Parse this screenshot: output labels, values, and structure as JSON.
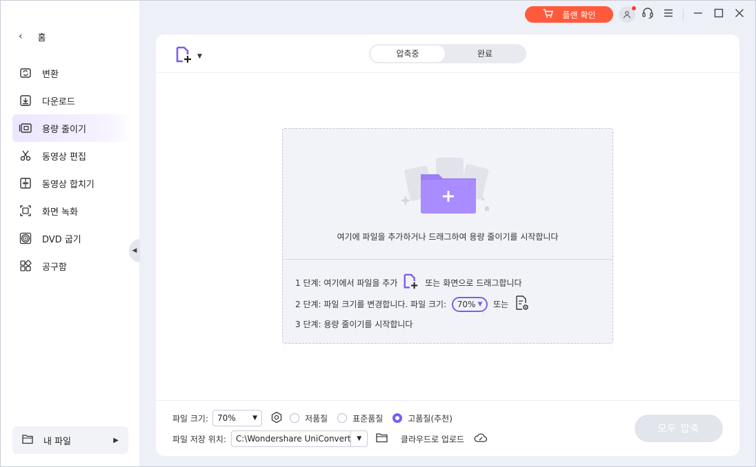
{
  "sidebar": {
    "home_label": "홈",
    "items": [
      {
        "label": "변환",
        "icon": "convert-icon"
      },
      {
        "label": "다운로드",
        "icon": "download-icon"
      },
      {
        "label": "용량 줄이기",
        "icon": "compress-icon"
      },
      {
        "label": "동영상 편집",
        "icon": "scissors-icon"
      },
      {
        "label": "동영상 합치기",
        "icon": "merge-icon"
      },
      {
        "label": "화면 녹화",
        "icon": "screen-record-icon"
      },
      {
        "label": "DVD 굽기",
        "icon": "dvd-icon"
      },
      {
        "label": "공구함",
        "icon": "toolbox-icon"
      }
    ],
    "active_index": 2,
    "my_files_label": "내 파일"
  },
  "topbar": {
    "plan_label": "플랜 확인"
  },
  "tabs": {
    "compressing": "압축중",
    "done": "완료"
  },
  "dropzone": {
    "message": "여기에 파일을 추가하거나 드래그하여 용량 줄이기를 시작합니다",
    "step1_pre": "1 단계: 여기에서 파일을 추가",
    "step1_post": "또는 화면으로 드래그합니다",
    "step2_pre": "2 단계: 파일 크기를 변경합니다.  파일 크기:",
    "step2_value": "70%",
    "step2_post": "또는",
    "step3": "3 단계: 용량 줄이기를 시작합니다"
  },
  "footer": {
    "file_size_label": "파일 크기:",
    "file_size_value": "70%",
    "quality_low": "저품질",
    "quality_std": "표준품질",
    "quality_high": "고품질(추천)",
    "save_location_label": "파일 저장 위치:",
    "save_location_value": "C:\\Wondershare UniConverte",
    "cloud_upload": "클라우드로 업로드",
    "compress_all": "모두 압축"
  },
  "colors": {
    "accent": "#7b5cf5",
    "plan_button": "#ff5a3c"
  }
}
